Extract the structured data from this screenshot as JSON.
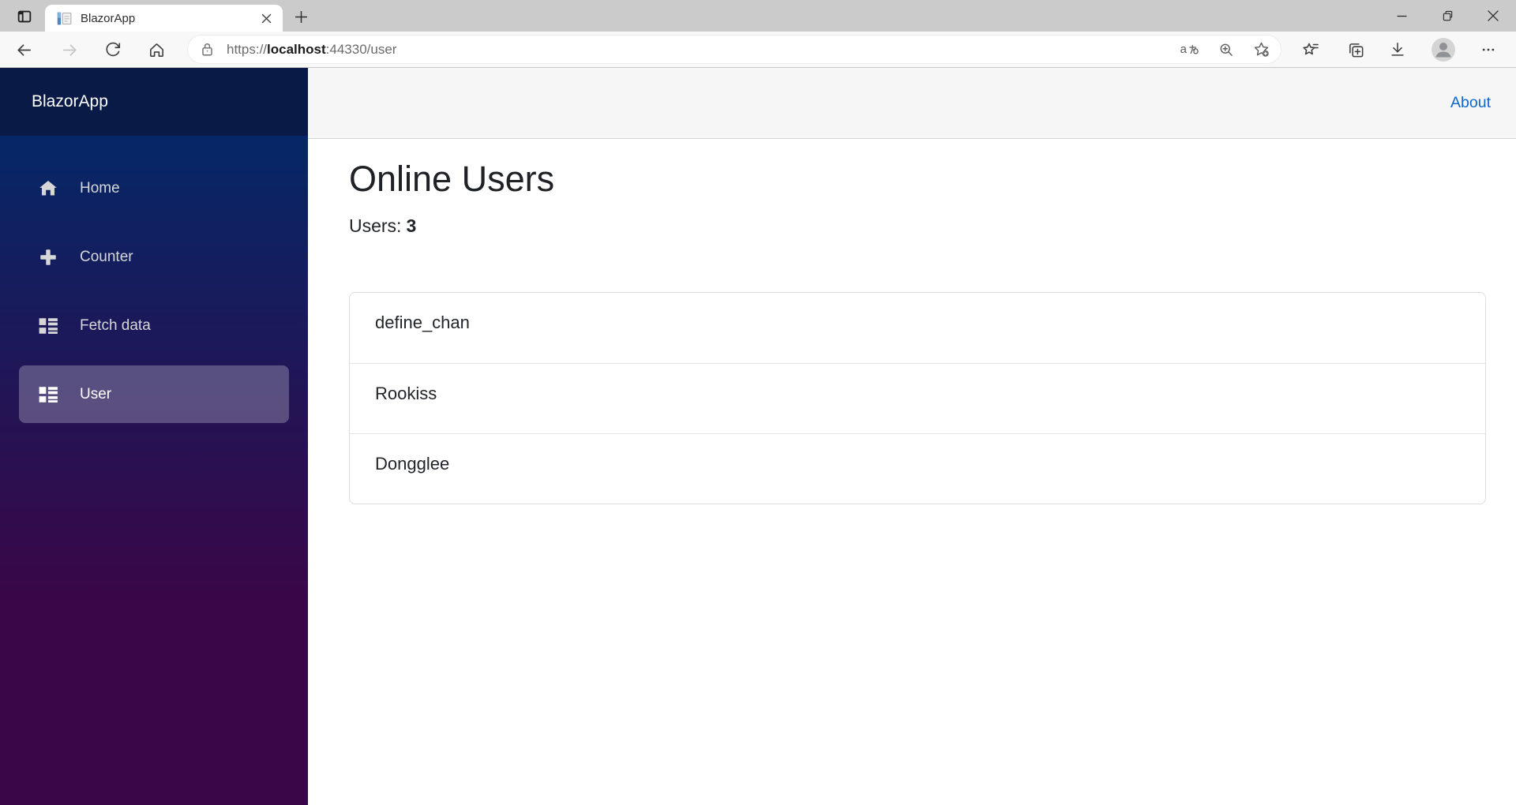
{
  "browser": {
    "tab_title": "BlazorApp",
    "address": {
      "scheme": "https://",
      "host": "localhost",
      "path": ":44330/user",
      "full": "https://localhost:44330/user"
    },
    "icons": [
      "tab-actions-icon",
      "favicon",
      "close-icon",
      "new-tab-icon",
      "minimize-icon",
      "restore-icon",
      "window-close-icon",
      "back-icon",
      "forward-icon",
      "refresh-icon",
      "home-icon",
      "lock-icon",
      "translate-icon",
      "zoom-in-icon",
      "add-favorite-icon",
      "favorites-icon",
      "collections-icon",
      "downloads-icon",
      "profile-avatar-icon",
      "more-icon"
    ]
  },
  "topbar": {
    "about_label": "About"
  },
  "sidebar": {
    "brand": "BlazorApp",
    "items": [
      {
        "label": "Home",
        "icon": "home-icon",
        "active": false
      },
      {
        "label": "Counter",
        "icon": "plus-icon",
        "active": false
      },
      {
        "label": "Fetch data",
        "icon": "list-rich-icon",
        "active": false
      },
      {
        "label": "User",
        "icon": "list-rich-icon",
        "active": true
      }
    ]
  },
  "main": {
    "title": "Online Users",
    "users_label": "Users:",
    "users_count": "3",
    "users": [
      {
        "name": "define_chan"
      },
      {
        "name": "Rookiss"
      },
      {
        "name": "Dongglee"
      }
    ]
  },
  "colors": {
    "tabstrip_bg": "#cbcbcb",
    "toolbar_bg": "#f8f8f8",
    "sidebar_header": "#0a1a46",
    "sidebar_gradient_top": "#052767",
    "sidebar_gradient_bottom": "#3a0647",
    "active_nav_bg": "rgba(255,255,255,0.25)",
    "topbar_bg": "#f6f6f6",
    "link_blue": "#0b66d0",
    "text_dark": "#212529"
  }
}
